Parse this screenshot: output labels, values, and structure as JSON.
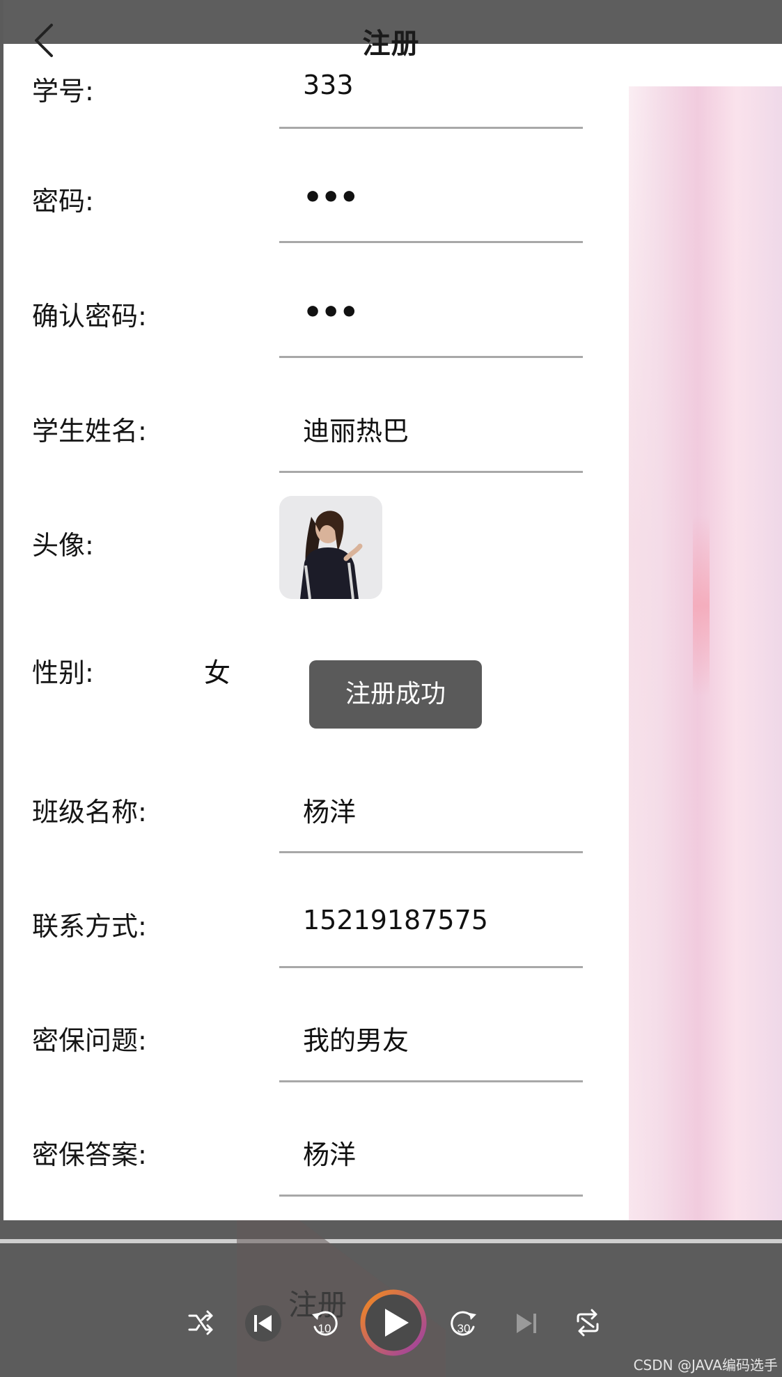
{
  "header": {
    "title": "注册"
  },
  "fields": [
    {
      "label": "学号:",
      "value": "333",
      "kind": "text"
    },
    {
      "label": "密码:",
      "value": "•••",
      "kind": "password"
    },
    {
      "label": "确认密码:",
      "value": "•••",
      "kind": "password"
    },
    {
      "label": "学生姓名:",
      "value": "迪丽热巴",
      "kind": "text"
    },
    {
      "label": "头像:",
      "kind": "avatar"
    },
    {
      "label": "性别:",
      "value": "女",
      "kind": "radio"
    },
    {
      "label": "班级名称:",
      "value": "杨洋",
      "kind": "text"
    },
    {
      "label": "联系方式:",
      "value": "15219187575",
      "kind": "text"
    },
    {
      "label": "密保问题:",
      "value": "我的男友",
      "kind": "text"
    },
    {
      "label": "密保答案:",
      "value": "杨洋",
      "kind": "text"
    }
  ],
  "toast": {
    "message": "注册成功"
  },
  "submit": {
    "label": "注册"
  },
  "player": {
    "controls": [
      "shuffle-icon",
      "previous-icon",
      "rewind-10-icon",
      "play-icon",
      "forward-30-icon",
      "next-icon",
      "repeat-icon"
    ],
    "rewind_label": "10",
    "forward_label": "30",
    "accent_gradient": [
      "#f38b1e",
      "#9b3ea6"
    ]
  },
  "watermark": "CSDN @JAVA编码选手"
}
